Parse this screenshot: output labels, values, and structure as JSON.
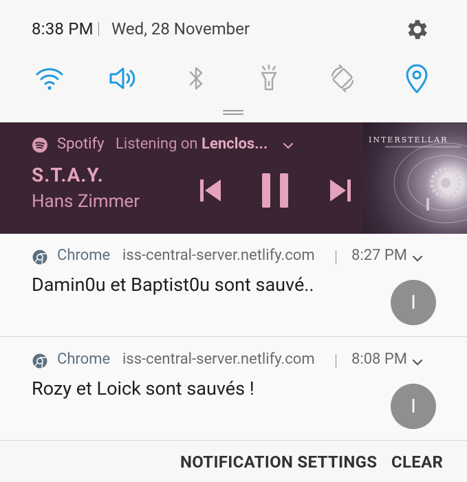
{
  "status": {
    "time": "8:38 PM",
    "date": "Wed, 28 November"
  },
  "quick_settings": [
    {
      "name": "wifi-icon",
      "active": true
    },
    {
      "name": "sound-icon",
      "active": true
    },
    {
      "name": "bluetooth-icon",
      "active": false
    },
    {
      "name": "flashlight-icon",
      "active": false
    },
    {
      "name": "auto-rotate-icon",
      "active": false
    },
    {
      "name": "location-icon",
      "active": true
    }
  ],
  "colors": {
    "active_icon": "#1e9be0",
    "inactive_icon": "#a9a9a9",
    "spotify_bg": "#3b2433",
    "spotify_text": "#d99bb4"
  },
  "spotify": {
    "app": "Spotify",
    "status_prefix": "Listening on",
    "device": "Lenclos...",
    "track": "S.T.A.Y.",
    "artist": "Hans Zimmer",
    "album_art_title": "INTERSTELLAR"
  },
  "notifications": [
    {
      "app": "Chrome",
      "site": "iss-central-server.netlify.com",
      "time": "8:27 PM",
      "message": "Damin0u et Baptist0u sont sauvé..",
      "avatar": "I"
    },
    {
      "app": "Chrome",
      "site": "iss-central-server.netlify.com",
      "time": "8:08 PM",
      "message": "Rozy  et Loick sont sauvés !",
      "avatar": "I"
    }
  ],
  "footer": {
    "settings_label": "NOTIFICATION SETTINGS",
    "clear_label": "CLEAR"
  }
}
